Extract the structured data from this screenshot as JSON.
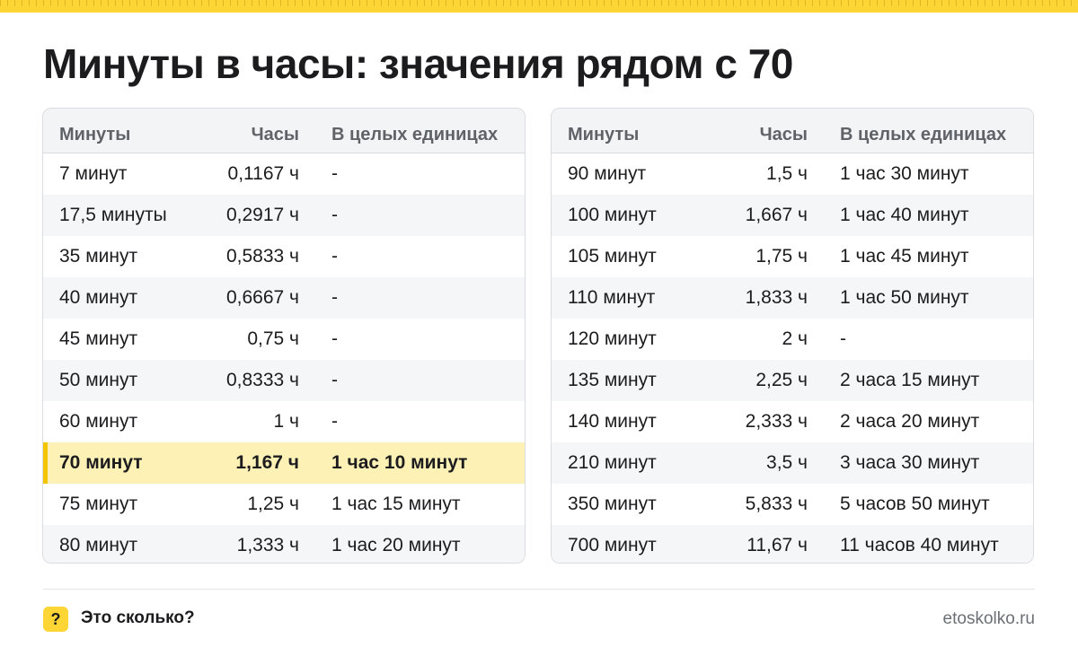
{
  "title": "Минуты в часы: значения рядом с 70",
  "headers": {
    "minutes": "Минуты",
    "hours": "Часы",
    "units": "В целых единицах"
  },
  "left_table": [
    {
      "minutes": "7 минут",
      "hours": "0,1167 ч",
      "units": "-"
    },
    {
      "minutes": "17,5 минуты",
      "hours": "0,2917 ч",
      "units": "-"
    },
    {
      "minutes": "35 минут",
      "hours": "0,5833 ч",
      "units": "-"
    },
    {
      "minutes": "40 минут",
      "hours": "0,6667 ч",
      "units": "-"
    },
    {
      "minutes": "45 минут",
      "hours": "0,75 ч",
      "units": "-"
    },
    {
      "minutes": "50 минут",
      "hours": "0,8333 ч",
      "units": "-"
    },
    {
      "minutes": "60 минут",
      "hours": "1 ч",
      "units": "-"
    },
    {
      "minutes": "70 минут",
      "hours": "1,167 ч",
      "units": "1 час 10 минут"
    },
    {
      "minutes": "75 минут",
      "hours": "1,25 ч",
      "units": "1 час 15 минут"
    },
    {
      "minutes": "80 минут",
      "hours": "1,333 ч",
      "units": "1 час 20 минут"
    }
  ],
  "right_table": [
    {
      "minutes": "90 минут",
      "hours": "1,5 ч",
      "units": "1 час 30 минут"
    },
    {
      "minutes": "100 минут",
      "hours": "1,667 ч",
      "units": "1 час 40 минут"
    },
    {
      "minutes": "105 минут",
      "hours": "1,75 ч",
      "units": "1 час 45 минут"
    },
    {
      "minutes": "110 минут",
      "hours": "1,833 ч",
      "units": "1 час 50 минут"
    },
    {
      "minutes": "120 минут",
      "hours": "2 ч",
      "units": "-"
    },
    {
      "minutes": "135 минут",
      "hours": "2,25 ч",
      "units": "2 часа 15 минут"
    },
    {
      "minutes": "140 минут",
      "hours": "2,333 ч",
      "units": "2 часа 20 минут"
    },
    {
      "minutes": "210 минут",
      "hours": "3,5 ч",
      "units": "3 часа 30 минут"
    },
    {
      "minutes": "350 минут",
      "hours": "5,833 ч",
      "units": "5 часов 50 минут"
    },
    {
      "minutes": "700 минут",
      "hours": "11,67 ч",
      "units": "11 часов 40 минут"
    }
  ],
  "highlighted_row": "70 минут",
  "footer": {
    "logo_glyph": "?",
    "name": "Это сколько?",
    "site": "etoskolko.ru"
  },
  "colors": {
    "accent": "#fdd535",
    "highlight_row": "#fdf1b6",
    "highlight_bar": "#f5c400"
  }
}
